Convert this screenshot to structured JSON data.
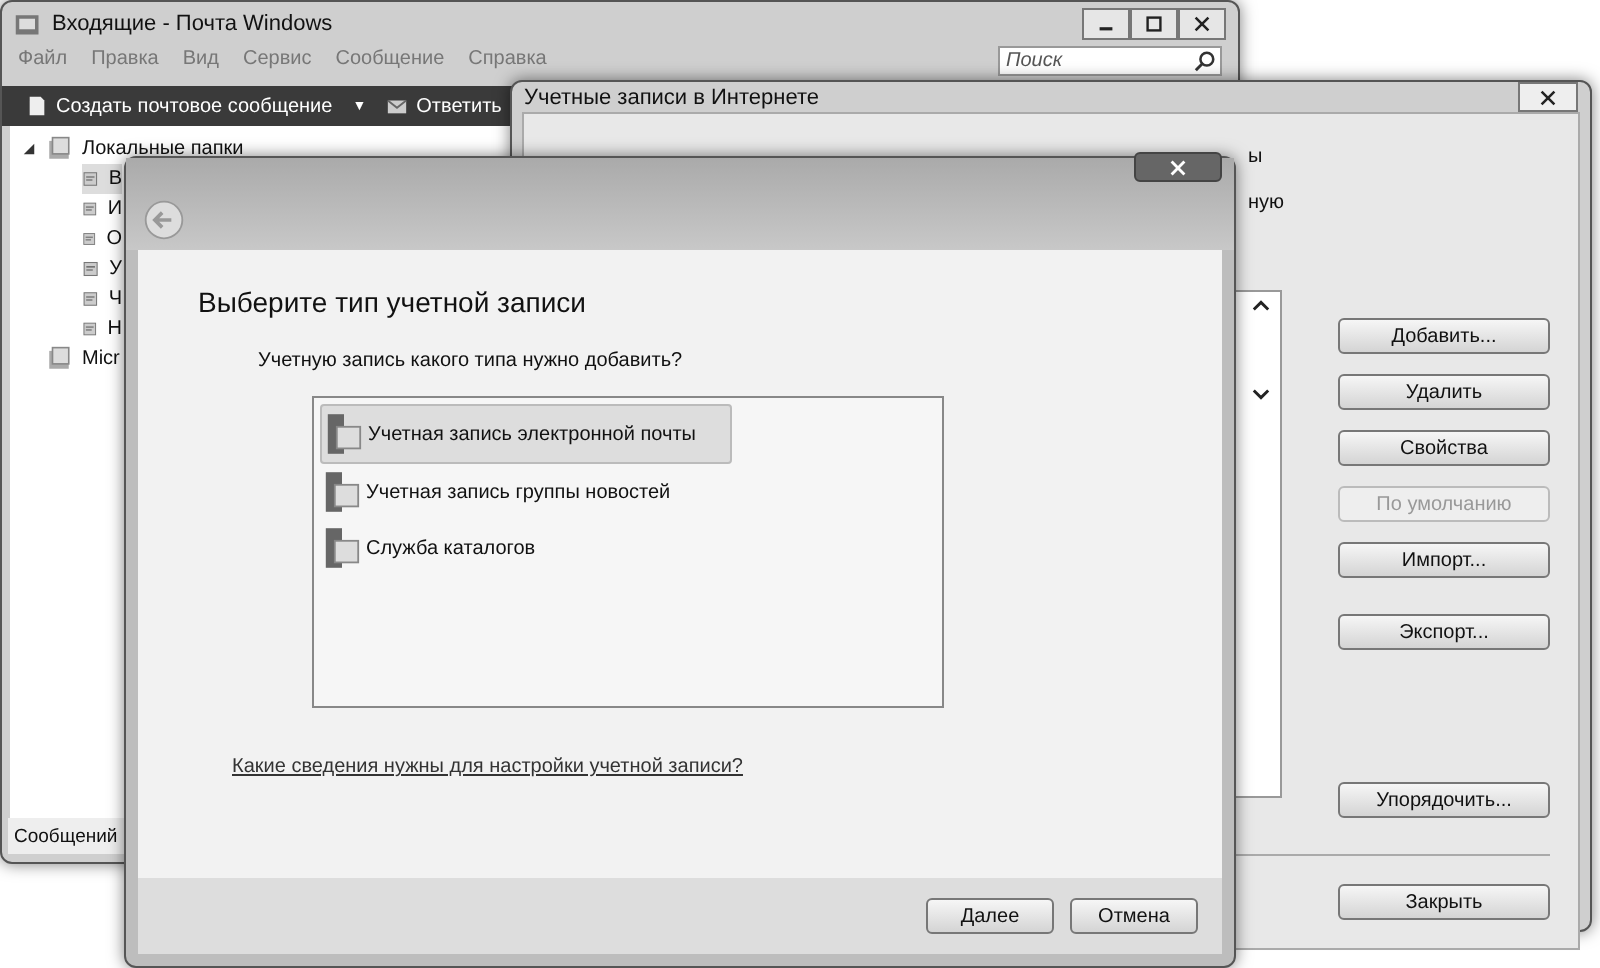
{
  "mail_window": {
    "title": "Входящие - Почта Windows",
    "menu": [
      "Файл",
      "Правка",
      "Вид",
      "Сервис",
      "Сообщение",
      "Справка"
    ],
    "search": {
      "placeholder": "Поиск"
    },
    "toolbar": [
      {
        "kind": "new",
        "label": "Создать почтовое сообщение"
      },
      {
        "kind": "dropdown",
        "label": "▼"
      },
      {
        "kind": "reply",
        "label": "Ответить"
      }
    ],
    "folders": [
      {
        "label": "Локальные папки",
        "expanded": true,
        "children": [
          {
            "label": "В",
            "selected": true
          },
          {
            "label": "И",
            "selected": false
          },
          {
            "label": "О",
            "selected": false
          },
          {
            "label": "У",
            "selected": false
          },
          {
            "label": "Ч",
            "selected": false
          },
          {
            "label": "Н",
            "selected": false
          }
        ]
      },
      {
        "label": "Micr"
      }
    ],
    "status_bar": "Сообщений"
  },
  "accounts_window": {
    "title": "Учетные записи в Интернете",
    "text_fragments": [
      "ы",
      "ную"
    ],
    "buttons": [
      {
        "label": "Добавить...",
        "disabled": false
      },
      {
        "label": "Удалить",
        "disabled": false
      },
      {
        "label": "Свойства",
        "disabled": false
      },
      {
        "label": "По умолчанию",
        "disabled": true
      },
      {
        "label": "Импорт...",
        "disabled": false
      },
      {
        "label": "Экспорт...",
        "disabled": false
      },
      {
        "label": "Упорядочить...",
        "disabled": false
      }
    ],
    "close_button": "Закрыть"
  },
  "dialog": {
    "heading": "Выберите тип учетной записи",
    "question": "Учетную запись какого типа нужно добавить?",
    "options": [
      {
        "label": "Учетная запись электронной почты",
        "selected": true
      },
      {
        "label": "Учетная запись группы новостей",
        "selected": false
      },
      {
        "label": "Служба каталогов",
        "selected": false
      }
    ],
    "help_link": "Какие сведения нужны для настройки учетной записи?",
    "buttons": [
      "Далее",
      "Отмена"
    ]
  }
}
